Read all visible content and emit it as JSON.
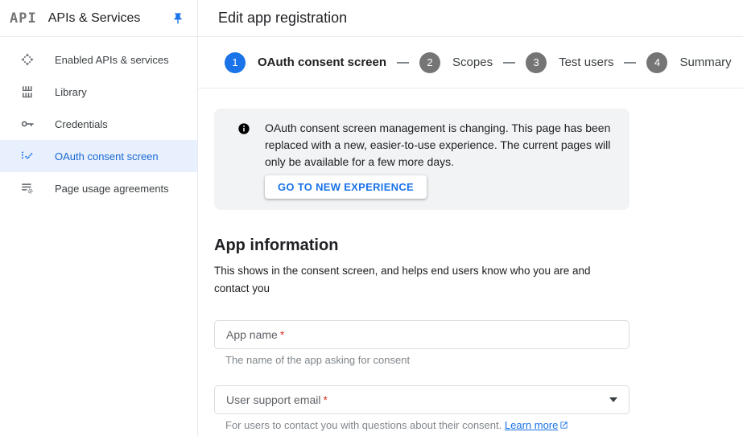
{
  "sidebar": {
    "logo": "API",
    "title": "APIs & Services",
    "items": [
      {
        "label": "Enabled APIs & services",
        "active": false
      },
      {
        "label": "Library",
        "active": false
      },
      {
        "label": "Credentials",
        "active": false
      },
      {
        "label": "OAuth consent screen",
        "active": true
      },
      {
        "label": "Page usage agreements",
        "active": false
      }
    ]
  },
  "header": {
    "title": "Edit app registration"
  },
  "stepper": {
    "steps": [
      {
        "number": "1",
        "label": "OAuth consent screen",
        "active": true
      },
      {
        "number": "2",
        "label": "Scopes",
        "active": false
      },
      {
        "number": "3",
        "label": "Test users",
        "active": false
      },
      {
        "number": "4",
        "label": "Summary",
        "active": false
      }
    ]
  },
  "banner": {
    "text": "OAuth consent screen management is changing. This page has been replaced with a new, easier-to-use experience. The current pages will only be available for a few more days.",
    "button_label": "GO TO NEW EXPERIENCE"
  },
  "section": {
    "title": "App information",
    "subtitle": "This shows in the consent screen, and helps end users know who you are and contact you"
  },
  "fields": {
    "app_name": {
      "label": "App name",
      "required_marker": "*",
      "helper": "The name of the app asking for consent"
    },
    "support_email": {
      "label": "User support email",
      "required_marker": "*",
      "helper": "For users to contact you with questions about their consent.",
      "link_label": "Learn more"
    }
  },
  "colors": {
    "accent": "#1a73e8",
    "active_item_bg": "#e8f0fe",
    "active_item_text": "#1967d2",
    "banner_bg": "#f1f3f4",
    "step_inactive": "#757575",
    "required": "#d93025"
  }
}
